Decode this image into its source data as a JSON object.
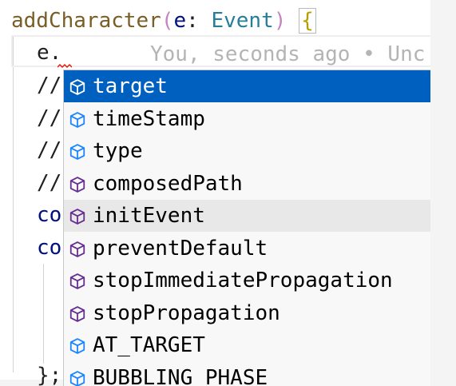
{
  "editor": {
    "signature": {
      "name": "addCharacter",
      "open_paren": "(",
      "param": "e",
      "colon": ": ",
      "type": "Event",
      "close_paren": ")",
      "space": " ",
      "brace": "{"
    },
    "typed_line": "e.",
    "ghost_blame": "You, seconds ago • Unc",
    "hidden_lines": [
      "//",
      "//",
      "//",
      "//",
      "co",
      "co"
    ],
    "last_line": "};"
  },
  "suggestions": {
    "selected_index": 0,
    "hovered_index": 4,
    "items": [
      {
        "label": "target",
        "icon": "field-cube-icon"
      },
      {
        "label": "timeStamp",
        "icon": "field-cube-icon"
      },
      {
        "label": "type",
        "icon": "field-cube-icon"
      },
      {
        "label": "composedPath",
        "icon": "method-cube-icon"
      },
      {
        "label": "initEvent",
        "icon": "method-cube-icon"
      },
      {
        "label": "preventDefault",
        "icon": "method-cube-icon"
      },
      {
        "label": "stopImmediatePropagation",
        "icon": "method-cube-icon"
      },
      {
        "label": "stopPropagation",
        "icon": "method-cube-icon"
      },
      {
        "label": "AT_TARGET",
        "icon": "field-cube-icon"
      },
      {
        "label": "BUBBLING_PHASE",
        "icon": "field-cube-icon"
      }
    ]
  },
  "colors": {
    "selected": "#0060c0",
    "field_icon": "#1a85ff",
    "method_icon": "#652d90"
  }
}
